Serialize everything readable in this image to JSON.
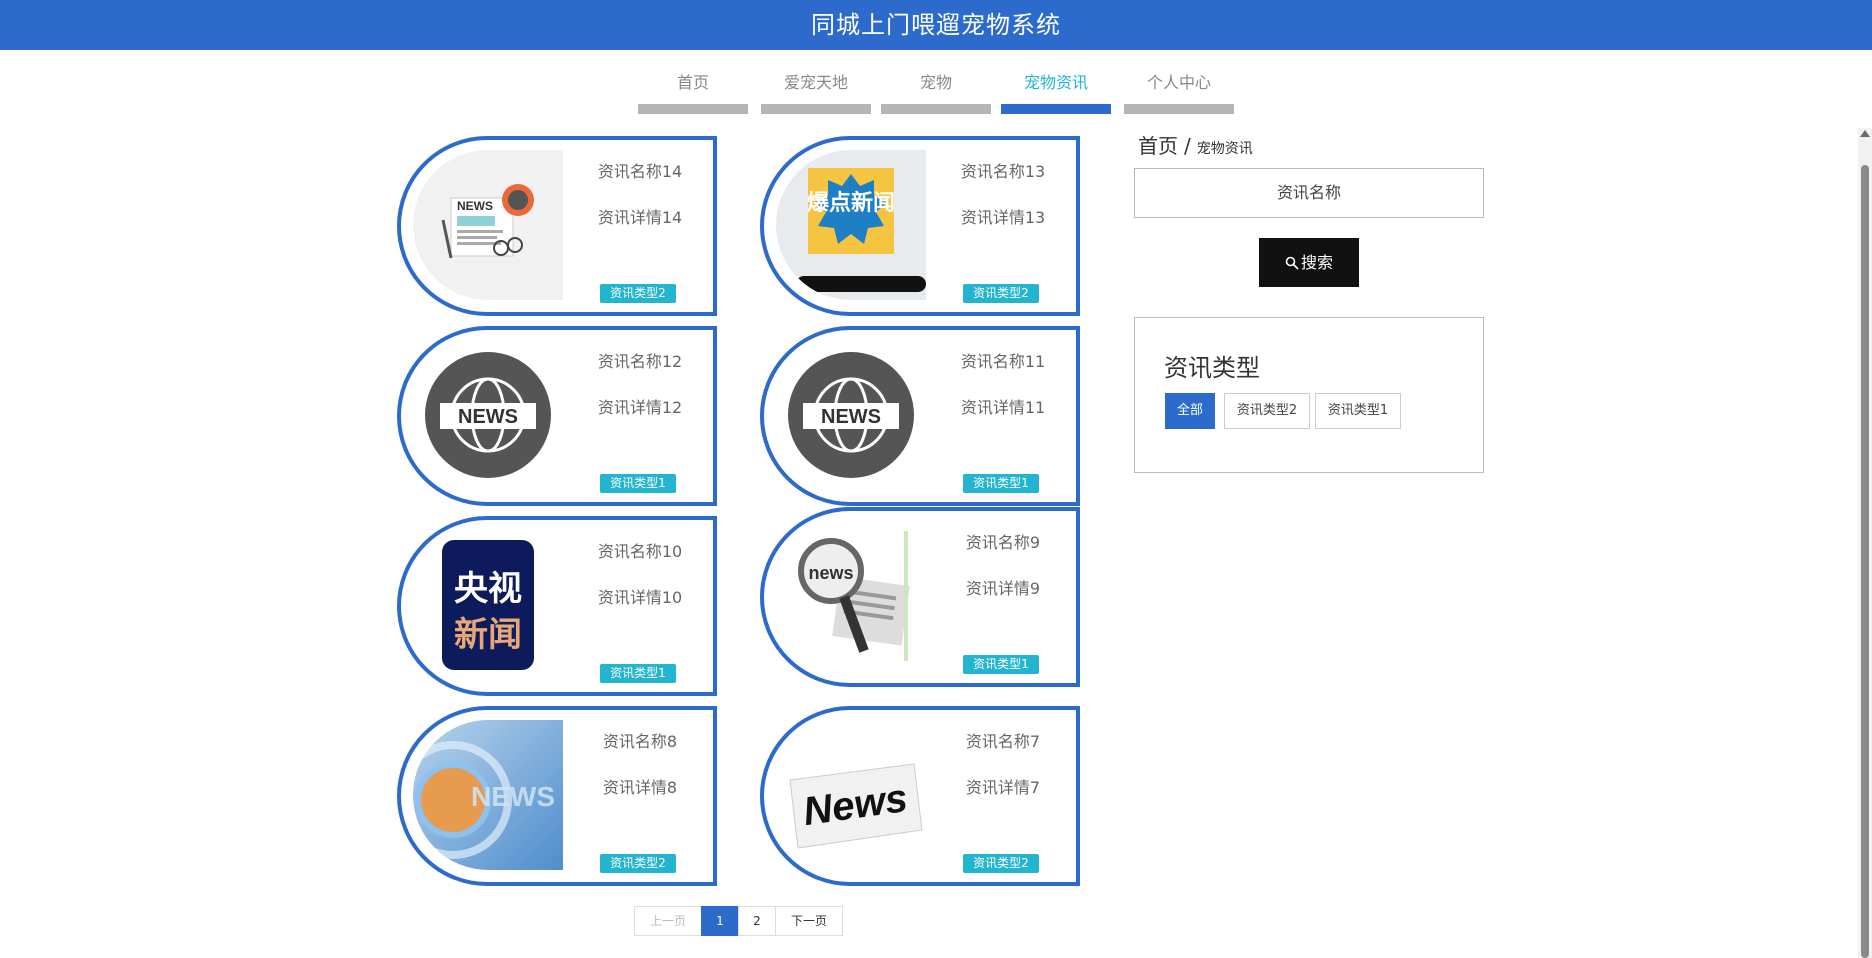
{
  "app": {
    "title": "同城上门喂遛宠物系统"
  },
  "nav": {
    "items": [
      {
        "label": "首页"
      },
      {
        "label": "爱宠天地"
      },
      {
        "label": "宠物"
      },
      {
        "label": "宠物资讯",
        "active": true
      },
      {
        "label": "个人中心"
      }
    ]
  },
  "cards": [
    {
      "name": "资讯名称14",
      "detail": "资讯详情14",
      "tag": "资讯类型2",
      "image": "newspaper-coffee-illustration"
    },
    {
      "name": "资讯名称13",
      "detail": "资讯详情13",
      "tag": "资讯类型2",
      "image": "breaking-news-phone-image",
      "image_text": "爆点新闻"
    },
    {
      "name": "资讯名称12",
      "detail": "资讯详情12",
      "tag": "资讯类型1",
      "image": "news-globe-icon",
      "image_text": "NEWS"
    },
    {
      "name": "资讯名称11",
      "detail": "资讯详情11",
      "tag": "资讯类型1",
      "image": "news-globe-icon",
      "image_text": "NEWS"
    },
    {
      "name": "资讯名称10",
      "detail": "资讯详情10",
      "tag": "资讯类型1",
      "image": "cctv-news-logo",
      "image_text": "央视新闻"
    },
    {
      "name": "资讯名称9",
      "detail": "资讯详情9",
      "tag": "资讯类型1",
      "image": "magnifier-newspaper-image",
      "image_text": "news"
    },
    {
      "name": "资讯名称8",
      "detail": "资讯详情8",
      "tag": "资讯类型2",
      "image": "globe-news-broadcast-image",
      "image_text": "NEWS"
    },
    {
      "name": "资讯名称7",
      "detail": "资讯详情7",
      "tag": "资讯类型2",
      "image": "newspaper-news-image",
      "image_text": "News"
    }
  ],
  "sidebar": {
    "breadcrumb": {
      "home": "首页",
      "separator": "/",
      "current": "宠物资讯"
    },
    "search": {
      "placeholder": "资讯名称",
      "button_label": "搜索"
    },
    "types": {
      "title": "资讯类型",
      "options": [
        {
          "label": "全部",
          "active": true
        },
        {
          "label": "资讯类型2"
        },
        {
          "label": "资讯类型1"
        }
      ]
    }
  },
  "pagination": {
    "prev": "上一页",
    "pages": [
      "1",
      "2"
    ],
    "current": "1",
    "next": "下一页"
  },
  "colors": {
    "header": "#2c6bcc",
    "accent": "#2c6bcc",
    "tag": "#23b5cf",
    "nav_active_text": "#23b5cf"
  }
}
